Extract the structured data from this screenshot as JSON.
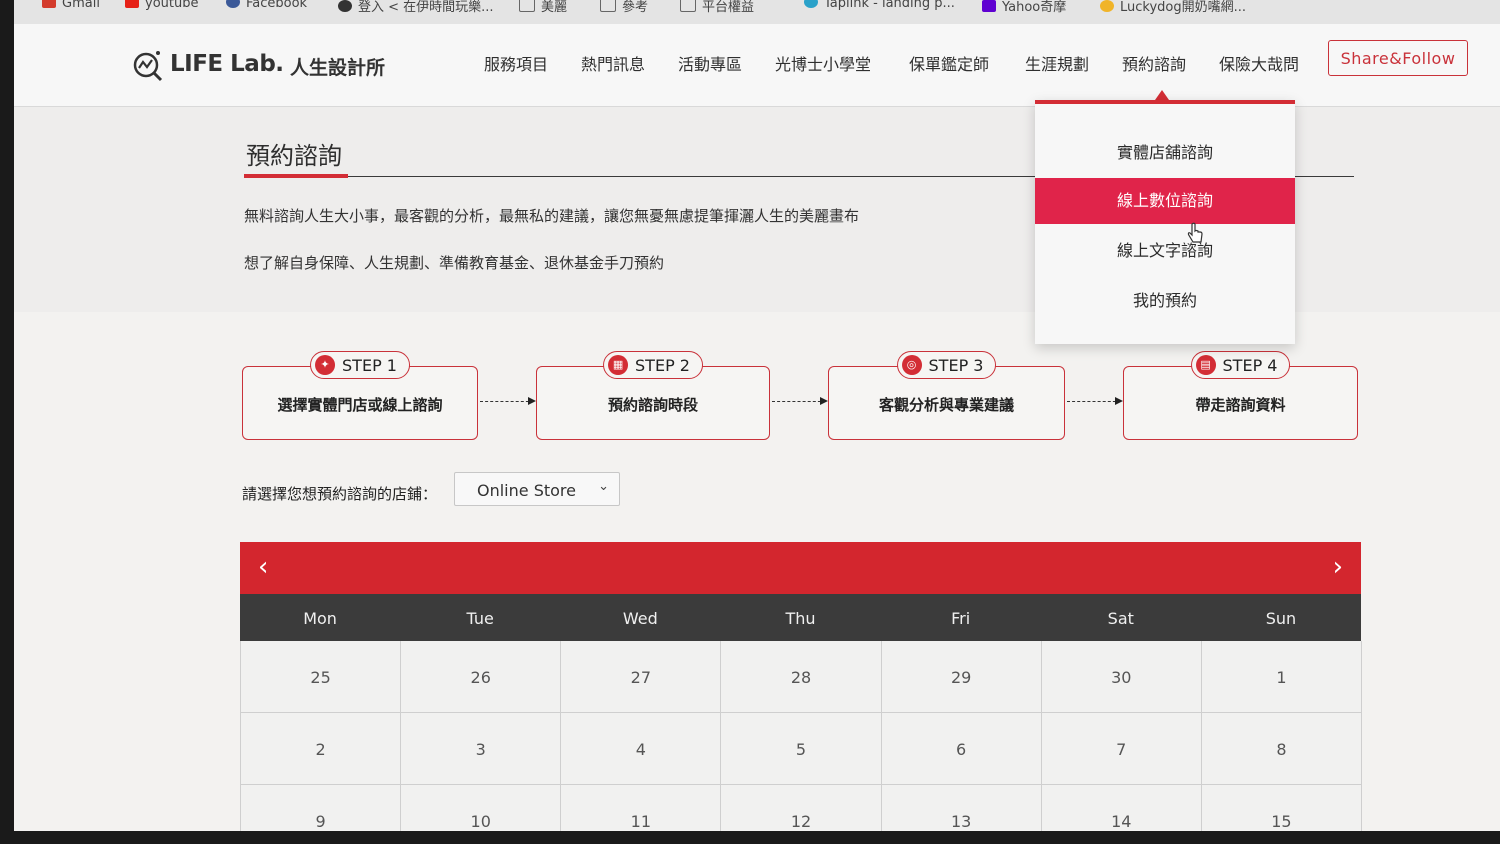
{
  "bookmarks": [
    {
      "label": "Gmail",
      "icon": "gmail-icon",
      "color": "#d33b2c"
    },
    {
      "label": "youtube",
      "icon": "youtube-icon",
      "color": "#e62117"
    },
    {
      "label": "Facebook",
      "icon": "facebook-icon",
      "color": "#3b5998"
    },
    {
      "label": "登入 < 在伊時間玩樂...",
      "icon": "globe-icon",
      "color": "#333333"
    },
    {
      "label": "美麗",
      "icon": "folder-icon",
      "color": "#666666"
    },
    {
      "label": "參考",
      "icon": "folder-icon",
      "color": "#666666"
    },
    {
      "label": "平台權益",
      "icon": "folder-icon",
      "color": "#666666"
    },
    {
      "label": "Taplink - landing p...",
      "icon": "taplink-icon",
      "color": "#2aa1c9"
    },
    {
      "label": "Yahoo奇摩",
      "icon": "yahoo-icon",
      "color": "#5f01d1"
    },
    {
      "label": "Luckydog開奶嘴網...",
      "icon": "bookmark-icon",
      "color": "#f0b429"
    }
  ],
  "header": {
    "logo_en": "LIFE Lab.",
    "logo_zh": "人生設計所",
    "nav": [
      "服務項目",
      "熱門訊息",
      "活動專區",
      "光博士小學堂",
      "保單鑑定師",
      "生涯規劃",
      "預約諮詢",
      "保險大哉問"
    ],
    "share_label": "Share&Follow"
  },
  "page": {
    "title": "預約諮詢",
    "intro_line1": "無料諮詢人生大小事，最客觀的分析，最無私的建議，讓您無憂無慮提筆揮灑人生的美麗畫布",
    "intro_line2": "想了解自身保障、人生規劃、準備教育基金、退休基金手刀預約"
  },
  "steps": [
    {
      "label": "STEP 1",
      "text": "選擇實體門店或線上諮詢",
      "icon": "lightbulb-icon"
    },
    {
      "label": "STEP 2",
      "text": "預約諮詢時段",
      "icon": "calendar-icon"
    },
    {
      "label": "STEP 3",
      "text": "客觀分析與專業建議",
      "icon": "target-icon"
    },
    {
      "label": "STEP 4",
      "text": "帶走諮詢資料",
      "icon": "document-icon"
    }
  ],
  "store": {
    "label": "請選擇您想預約諮詢的店鋪：",
    "value": "Online Store"
  },
  "calendar": {
    "days": [
      "Mon",
      "Tue",
      "Wed",
      "Thu",
      "Fri",
      "Sat",
      "Sun"
    ],
    "weeks": [
      [
        "25",
        "26",
        "27",
        "28",
        "29",
        "30",
        "1"
      ],
      [
        "2",
        "3",
        "4",
        "5",
        "6",
        "7",
        "8"
      ],
      [
        "9",
        "10",
        "11",
        "12",
        "13",
        "14",
        "15"
      ]
    ]
  },
  "dropdown": {
    "items": [
      "實體店舖諮詢",
      "線上數位諮詢",
      "線上文字諮詢",
      "我的預約"
    ],
    "active_index": 1
  },
  "colors": {
    "brand_red": "#d32d35",
    "active_pink": "#e0244a",
    "day_header": "#3b3b3b"
  }
}
